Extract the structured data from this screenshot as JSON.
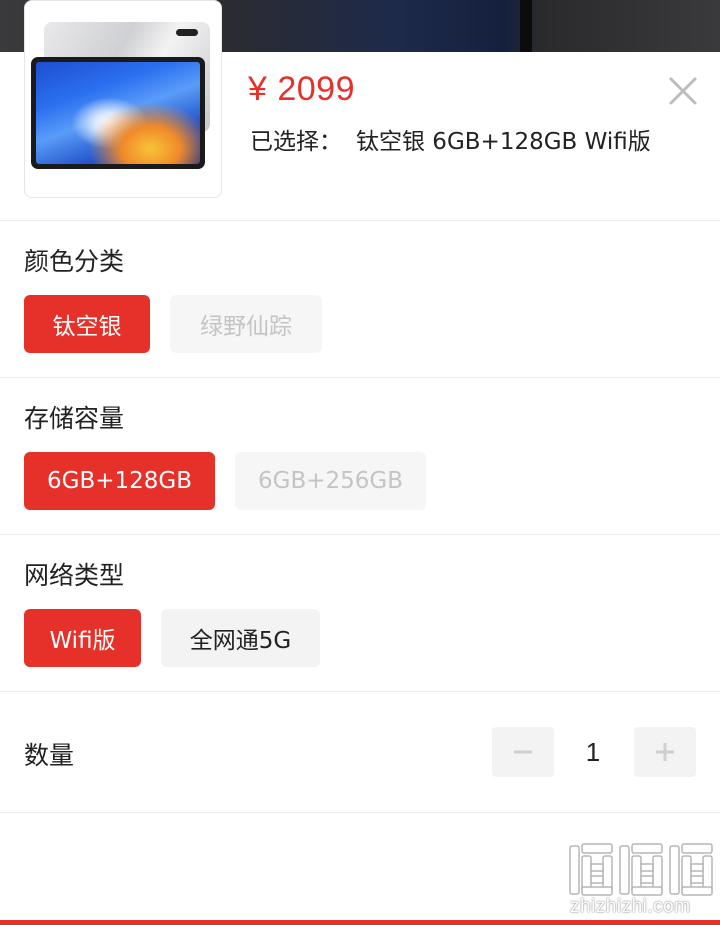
{
  "product": {
    "price": "¥ 2099",
    "selected_label": "已选择：",
    "selected_value": "钛空银 6GB+128GB Wifi版"
  },
  "sections": {
    "color": {
      "title": "颜色分类",
      "options": [
        {
          "label": "钛空银",
          "state": "selected"
        },
        {
          "label": "绿野仙踪",
          "state": "disabled"
        }
      ]
    },
    "storage": {
      "title": "存储容量",
      "options": [
        {
          "label": "6GB+128GB",
          "state": "selected"
        },
        {
          "label": "6GB+256GB",
          "state": "disabled"
        }
      ]
    },
    "network": {
      "title": "网络类型",
      "options": [
        {
          "label": "Wifi版",
          "state": "selected"
        },
        {
          "label": "全网通5G",
          "state": "available"
        }
      ]
    }
  },
  "quantity": {
    "title": "数量",
    "value": "1"
  },
  "watermark": {
    "text": "值值值",
    "url": "zhizhizhi.com"
  },
  "colors": {
    "accent": "#e5312a",
    "option_bg": "#f3f3f3",
    "disabled_text": "#c4c4c4"
  },
  "icons": [
    "close-icon",
    "minus-icon",
    "plus-icon"
  ]
}
